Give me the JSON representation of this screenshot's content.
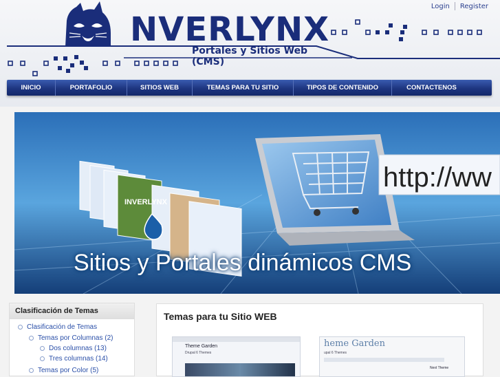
{
  "auth": {
    "login": "Login",
    "register": "Register"
  },
  "logo": {
    "name": "NVERLYNX",
    "tagline": "Portales y Sitios Web (CMS)"
  },
  "nav": {
    "items": [
      {
        "label": "INICIO"
      },
      {
        "label": "PORTAFOLIO"
      },
      {
        "label": "SITIOS WEB"
      },
      {
        "label": "TEMAS PARA TU SITIO"
      },
      {
        "label": "TIPOS DE CONTENIDO"
      },
      {
        "label": "CONTACTENOS"
      }
    ]
  },
  "banner": {
    "caption": "Sitios y Portales dinámicos CMS",
    "url_text": "http://ww",
    "mock_brand": "INVERLYNX"
  },
  "sidebar": {
    "title": "Clasificación de Temas",
    "items": [
      {
        "label": "Clasificación de Temas"
      },
      {
        "label": "Temas por Columnas (2)"
      },
      {
        "label": "Dos columnas (13)"
      },
      {
        "label": "Tres columnas (14)"
      },
      {
        "label": "Temas por Color (5)"
      }
    ]
  },
  "content": {
    "title": "Temas para tu Sitio WEB",
    "thumb1": {
      "title": "Theme Garden",
      "subtitle": "Drupal 6 Themes"
    },
    "thumb2": {
      "title": "heme Garden",
      "subtitle": "upal 6 Themes",
      "side": "Next Theme"
    }
  },
  "colors": {
    "brand": "#1a2d7a",
    "nav": "#1e3580",
    "link": "#2a4fa8"
  }
}
